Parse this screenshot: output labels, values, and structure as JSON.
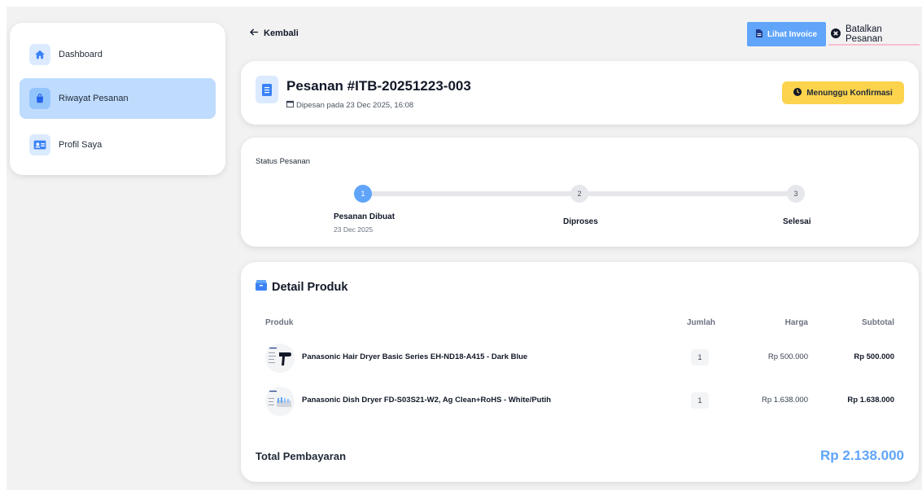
{
  "sidebar": {
    "items": [
      {
        "label": "Dashboard",
        "icon": "home-icon"
      },
      {
        "label": "Riwayat Pesanan",
        "icon": "shopping-bag-icon",
        "active": true
      },
      {
        "label": "Profil Saya",
        "icon": "id-card-icon"
      }
    ]
  },
  "topbar": {
    "back_label": "Kembali",
    "invoice_label": "Lihat Invoice",
    "cancel_label": "Batalkan Pesanan"
  },
  "order": {
    "title": "Pesanan #ITB-20251223-003",
    "date": "Dipesan pada 23 Dec 2025, 16:08",
    "status": "Menunggu Konfirmasi"
  },
  "status_section": {
    "title": "Status Pesanan",
    "steps": [
      {
        "number": "1",
        "label": "Pesanan Dibuat",
        "date": "23 Dec 2025"
      },
      {
        "number": "2",
        "label": "Diproses",
        "date": ""
      },
      {
        "number": "3",
        "label": "Selesai",
        "date": ""
      }
    ],
    "current_step": 1
  },
  "products": {
    "title": "Detail Produk",
    "headers": {
      "product": "Produk",
      "qty": "Jumlah",
      "price": "Harga",
      "subtotal": "Subtotal"
    },
    "rows": [
      {
        "name": "Panasonic Hair Dryer Basic Series EH-ND18-A415 - Dark Blue",
        "qty": "1",
        "price": "Rp 500.000",
        "subtotal": "Rp 500.000"
      },
      {
        "name": "Panasonic Dish Dryer FD-S03S21-W2, Ag Clean+RoHS - White/Putih",
        "qty": "1",
        "price": "Rp 1.638.000",
        "subtotal": "Rp 1.638.000"
      }
    ],
    "total_label": "Total Pembayaran",
    "total_value": "Rp 2.138.000"
  },
  "colors": {
    "accent": "#60a5fa",
    "active_nav": "#bfdbfe",
    "badge": "#fcd34d"
  }
}
